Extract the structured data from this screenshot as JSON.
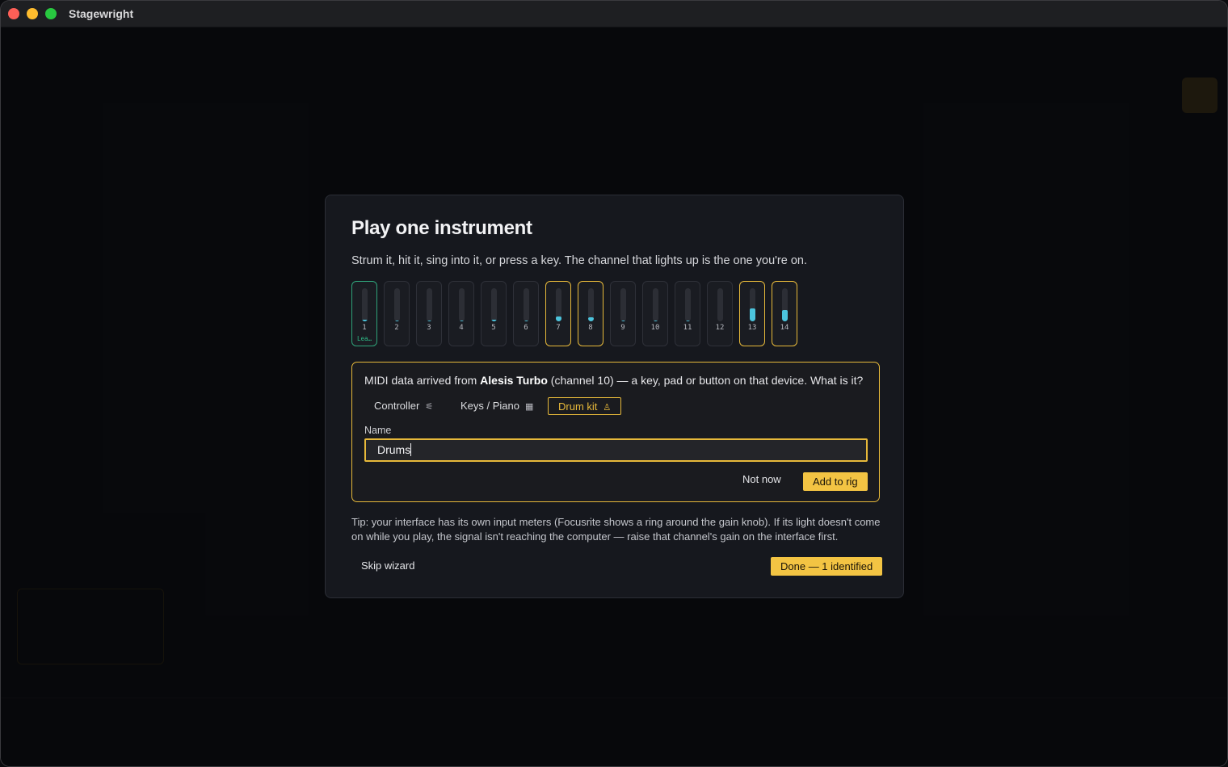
{
  "app": {
    "title": "Stagewright"
  },
  "colors": {
    "accent": "#f3c443",
    "meter": "#4cc4dd",
    "assigned": "#2fa37a"
  },
  "wizard": {
    "title": "Play one instrument",
    "subtitle": "Strum it, hit it, sing into it, or press a key. The channel that lights up is the one you're on.",
    "channels": [
      {
        "number": "1",
        "name": "Lea…",
        "level": 0.05,
        "state": "assigned"
      },
      {
        "number": "2",
        "name": "",
        "level": 0.03,
        "state": "idle"
      },
      {
        "number": "3",
        "name": "",
        "level": 0.03,
        "state": "idle"
      },
      {
        "number": "4",
        "name": "",
        "level": 0.03,
        "state": "idle"
      },
      {
        "number": "5",
        "name": "",
        "level": 0.05,
        "state": "idle"
      },
      {
        "number": "6",
        "name": "",
        "level": 0.03,
        "state": "idle"
      },
      {
        "number": "7",
        "name": "",
        "level": 0.15,
        "state": "active"
      },
      {
        "number": "8",
        "name": "",
        "level": 0.12,
        "state": "active"
      },
      {
        "number": "9",
        "name": "",
        "level": 0.03,
        "state": "idle"
      },
      {
        "number": "10",
        "name": "",
        "level": 0.03,
        "state": "idle"
      },
      {
        "number": "11",
        "name": "",
        "level": 0.03,
        "state": "idle"
      },
      {
        "number": "12",
        "name": "",
        "level": 0.0,
        "state": "idle"
      },
      {
        "number": "13",
        "name": "",
        "level": 0.4,
        "state": "active"
      },
      {
        "number": "14",
        "name": "",
        "level": 0.35,
        "state": "active"
      }
    ],
    "detect": {
      "msg_prefix": "MIDI data arrived from ",
      "device": "Alesis Turbo",
      "msg_suffix": " (channel 10) — a key, pad or button on that device. What is it?",
      "kinds": [
        {
          "label": "Controller",
          "icon": "sliders-icon",
          "glyph": "⚟",
          "selected": false
        },
        {
          "label": "Keys / Piano",
          "icon": "keyboard-icon",
          "glyph": "▦",
          "selected": false
        },
        {
          "label": "Drum kit",
          "icon": "drum-icon",
          "glyph": "♙",
          "selected": true
        }
      ],
      "name_label": "Name",
      "name_value": "Drums",
      "not_now": "Not now",
      "add_to_rig": "Add to rig"
    },
    "tip": "Tip: your interface has its own input meters (Focusrite shows a ring around the gain knob). If its light doesn't come on while you play, the signal isn't reaching the computer — raise that channel's gain on the interface first.",
    "skip": "Skip wizard",
    "done": "Done — 1 identified"
  }
}
